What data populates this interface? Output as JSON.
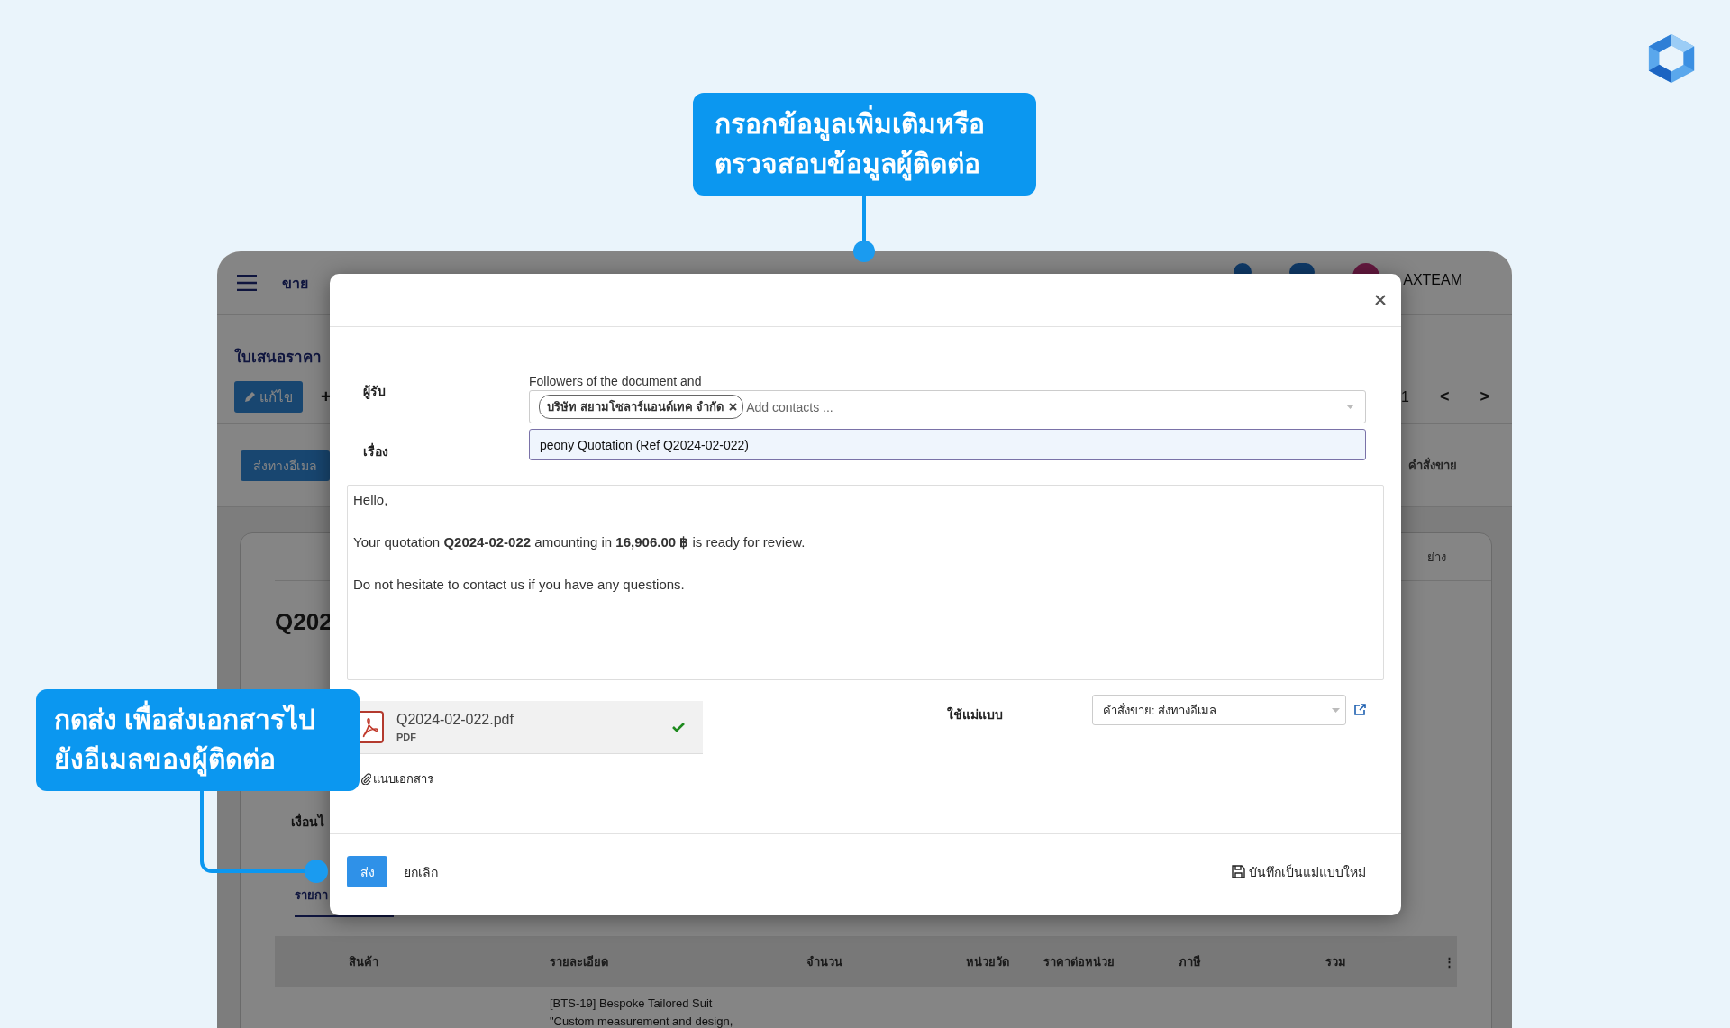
{
  "callouts": [
    {
      "lines": [
        "กรอกข้อมูลเพิ่มเติมหรือ",
        "ตรวจสอบข้อมูลผู้ติดต่อ"
      ]
    },
    {
      "lines": [
        "กดส่ง เพื่อส่งเอกสารไป",
        "ยังอีเมลของผู้ติดต่อ"
      ]
    }
  ],
  "app": {
    "header": {
      "module": "ขาย",
      "user": "AXTEAM"
    },
    "page_title": "ใบเสนอราคา",
    "edit_button": "แก้ไข",
    "add_symbol": "+",
    "pager": {
      "value": "1",
      "prev": "<",
      "next": ">"
    },
    "email_button": "ส่งทางอีเมล",
    "smart_button": "คำสั่งขาย",
    "sheet": {
      "tab_right": "ย่าง",
      "doc_number": "Q202",
      "field_label": "เงื่อนไ",
      "lines_tab": "รายกา",
      "table": {
        "columns": [
          "สินค้า",
          "รายละเอียด",
          "จำนวน",
          "หน่วยวัด",
          "ราคาต่อหน่วย",
          "ภาษี",
          "รวม",
          "⋮"
        ],
        "rows": [
          {
            "description": [
              "[BTS-19] Bespoke Tailored Suit",
              "\"Custom measurement and design,"
            ]
          }
        ]
      }
    }
  },
  "dialog": {
    "recipients_label": "ผู้รับ",
    "recipients_hint": "Followers of the document and",
    "recipients": [
      {
        "name": "บริษัท สยามโซลาร์แอนด์เทค จำกัด"
      }
    ],
    "recipients_placeholder": "Add contacts ...",
    "subject_label": "เรื่อง",
    "subject": "peony Quotation (Ref Q2024-02-022)",
    "body": [
      "Hello,",
      "Your quotation **Q2024-02-022** amounting in **16,906.00 ฿** is ready for review.",
      "Do not hesitate to contact us if you have any questions."
    ],
    "attachments": [
      {
        "name": "Q2024-02-022.pdf",
        "type": "PDF",
        "uploaded": true
      }
    ],
    "attach_link": "แนบเอกสาร",
    "template_label": "ใช้แม่แบบ",
    "template": "คำสั่งขาย: ส่งทางอีเมล",
    "send_button": "ส่ง",
    "cancel_button": "ยกเลิก",
    "save_template_button": "บันทึกเป็นแม่แบบใหม่"
  }
}
